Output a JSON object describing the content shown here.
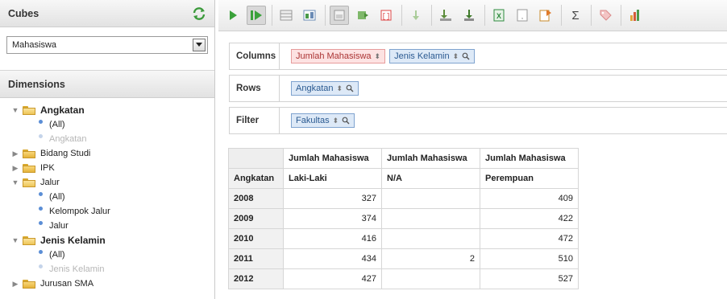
{
  "cubes": {
    "title": "Cubes",
    "selected_cube": "Mahasiswa"
  },
  "dimensions": {
    "title": "Dimensions",
    "tree": {
      "angkatan": {
        "label": "Angkatan",
        "children": [
          "(All)",
          "Angkatan"
        ]
      },
      "bidang_studi": {
        "label": "Bidang Studi"
      },
      "ipk": {
        "label": "IPK"
      },
      "jalur": {
        "label": "Jalur",
        "children": [
          "(All)",
          "Kelompok Jalur",
          "Jalur"
        ]
      },
      "jenis_kelamin": {
        "label": "Jenis Kelamin",
        "children": [
          "(All)",
          "Jenis Kelamin"
        ]
      },
      "jurusan_sma": {
        "label": "Jurusan SMA"
      }
    }
  },
  "toolbar": {
    "icons": [
      "play-icon",
      "auto-run-icon",
      "hide-parents-icon",
      "non-empty-icon",
      "swap-axes-icon",
      "drill-icon",
      "mdx-icon",
      "export-icon",
      "drill-down-icon",
      "drill-through-icon",
      "excel-icon",
      "csv-icon",
      "pdf-icon",
      "totals-icon",
      "tag-icon",
      "chart-icon"
    ],
    "sigma": "Σ",
    "colors": {
      "play": "#3aa13a",
      "excel": "#2e8b3e",
      "export": "#5c8c3b"
    }
  },
  "axes": {
    "columns": {
      "label": "Columns",
      "measures": [
        "Jumlah Mahasiswa"
      ],
      "dimensions": [
        "Jenis Kelamin"
      ]
    },
    "rows": {
      "label": "Rows",
      "dimensions": [
        "Angkatan"
      ]
    },
    "filter": {
      "label": "Filter",
      "dimensions": [
        "Fakultas"
      ]
    }
  },
  "pivot": {
    "measure_headers": [
      "Jumlah Mahasiswa",
      "Jumlah Mahasiswa",
      "Jumlah Mahasiswa"
    ],
    "row_dimension": "Angkatan",
    "member_headers": [
      "Laki-Laki",
      "N/A",
      "Perempuan"
    ],
    "rows": [
      {
        "year": "2008",
        "values": [
          "327",
          "",
          "409"
        ]
      },
      {
        "year": "2009",
        "values": [
          "374",
          "",
          "422"
        ]
      },
      {
        "year": "2010",
        "values": [
          "416",
          "",
          "472"
        ]
      },
      {
        "year": "2011",
        "values": [
          "434",
          "2",
          "510"
        ]
      },
      {
        "year": "2012",
        "values": [
          "427",
          "",
          "527"
        ]
      }
    ]
  }
}
